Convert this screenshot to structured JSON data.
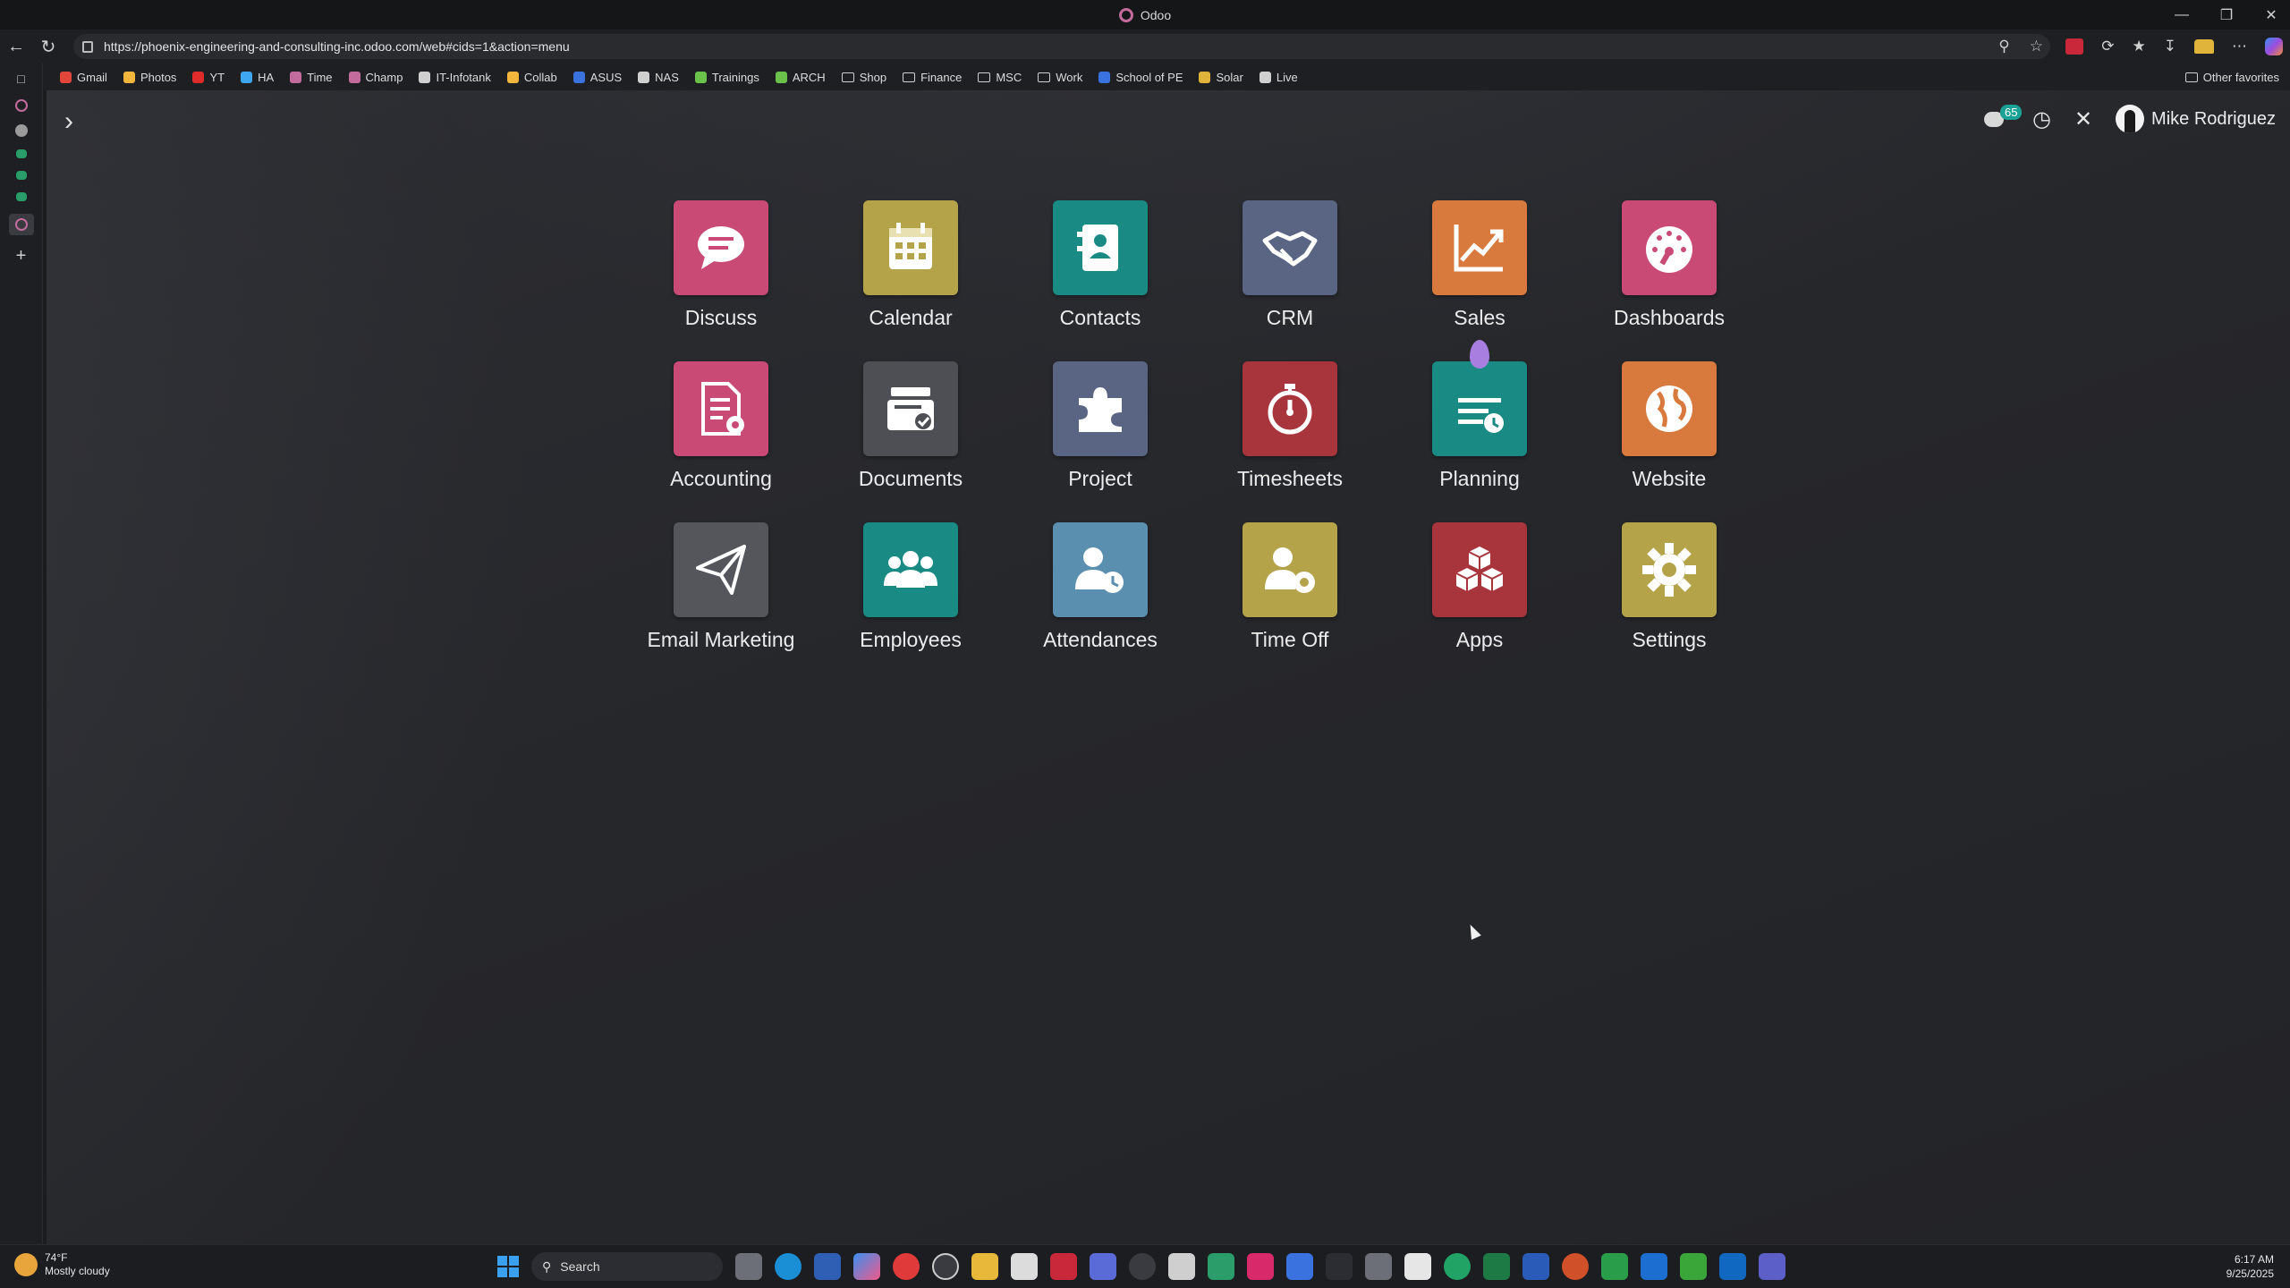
{
  "browser": {
    "window_title": "Odoo",
    "url": "https://phoenix-engineering-and-consulting-inc.odoo.com/web#cids=1&action=menu",
    "favorites": [
      {
        "label": "Gmail",
        "color": "#e2463a"
      },
      {
        "label": "Photos",
        "color": "#f2b63c"
      },
      {
        "label": "YT",
        "color": "#e02b2b"
      },
      {
        "label": "HA",
        "color": "#3fa7ef"
      },
      {
        "label": "Time",
        "color": "#c46b9e"
      },
      {
        "label": "Champ",
        "color": "#c46b9e"
      },
      {
        "label": "IT-Infotank",
        "color": "#d0d0d0"
      },
      {
        "label": "Collab",
        "color": "#f2b63c"
      },
      {
        "label": "ASUS",
        "color": "#3a72e0"
      },
      {
        "label": "NAS",
        "color": "#d0d0d0"
      },
      {
        "label": "Trainings",
        "color": "#6bc24a"
      },
      {
        "label": "ARCH",
        "color": "#6bc24a"
      },
      {
        "label": "Shop",
        "color": "folder"
      },
      {
        "label": "Finance",
        "color": "folder"
      },
      {
        "label": "MSC",
        "color": "folder"
      },
      {
        "label": "Work",
        "color": "folder"
      },
      {
        "label": "School of PE",
        "color": "#3a72e0"
      },
      {
        "label": "Solar",
        "color": "#e0b33a"
      },
      {
        "label": "Live",
        "color": "#d0d0d0"
      }
    ],
    "other_favorites": "Other favorites"
  },
  "systray": {
    "messages_count": "65",
    "user_name": "Mike Rodriguez"
  },
  "apps": [
    {
      "label": "Discuss",
      "color": "#c94a75",
      "icon": "chat-icon"
    },
    {
      "label": "Calendar",
      "color": "#b5a34a",
      "icon": "calendar-icon"
    },
    {
      "label": "Contacts",
      "color": "#198a84",
      "icon": "contact-card-icon"
    },
    {
      "label": "CRM",
      "color": "#5a6583",
      "icon": "handshake-icon"
    },
    {
      "label": "Sales",
      "color": "#d87a3e",
      "icon": "trend-chart-icon"
    },
    {
      "label": "Dashboards",
      "color": "#c94a75",
      "icon": "gauge-icon"
    },
    {
      "label": "Accounting",
      "color": "#c94a75",
      "icon": "document-gear-icon"
    },
    {
      "label": "Documents",
      "color": "#4e4f55",
      "icon": "inbox-check-icon"
    },
    {
      "label": "Project",
      "color": "#5a6583",
      "icon": "puzzle-icon"
    },
    {
      "label": "Timesheets",
      "color": "#a8343c",
      "icon": "stopwatch-icon"
    },
    {
      "label": "Planning",
      "color": "#198a84",
      "icon": "planning-icon"
    },
    {
      "label": "Website",
      "color": "#d87a3e",
      "icon": "globe-icon"
    },
    {
      "label": "Email Marketing",
      "color": "#55565c",
      "icon": "paper-plane-icon"
    },
    {
      "label": "Employees",
      "color": "#198a84",
      "icon": "people-icon"
    },
    {
      "label": "Attendances",
      "color": "#5b8fb0",
      "icon": "user-clock-icon"
    },
    {
      "label": "Time Off",
      "color": "#b5a34a",
      "icon": "user-gear-icon"
    },
    {
      "label": "Apps",
      "color": "#a8343c",
      "icon": "cubes-icon"
    },
    {
      "label": "Settings",
      "color": "#b5a34a",
      "icon": "gear-icon"
    }
  ],
  "taskbar": {
    "weather_temp": "74°F",
    "weather_desc": "Mostly cloudy",
    "search_placeholder": "Search",
    "time": "6:17 AM",
    "date": "9/25/2025"
  }
}
